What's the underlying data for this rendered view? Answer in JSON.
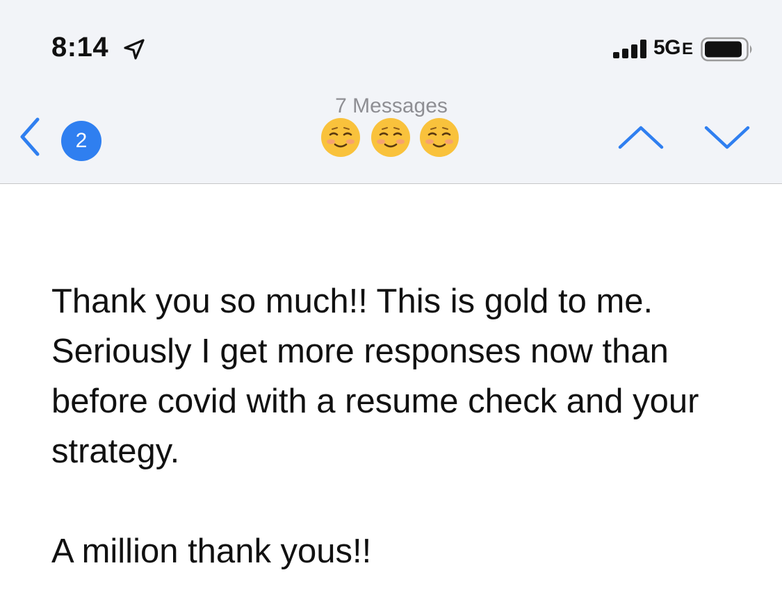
{
  "status_bar": {
    "time": "8:14",
    "network": "5G",
    "network_suffix": "E",
    "icons": [
      "location-arrow-icon",
      "cellular-signal-icon",
      "battery-icon"
    ]
  },
  "nav": {
    "back_badge_count": "2",
    "title": "7 Messages",
    "subject_emojis": [
      "☺️",
      "☺️",
      "☺️"
    ],
    "icons": [
      "chevron-left-icon",
      "chevron-up-icon",
      "chevron-down-icon"
    ],
    "accent_color": "#2f7ff0"
  },
  "message": {
    "body": "Thank you so much!! This is gold to me. Seriously I get more responses now than before covid with a resume check and your strategy.",
    "closing": "A million thank yous!!"
  }
}
